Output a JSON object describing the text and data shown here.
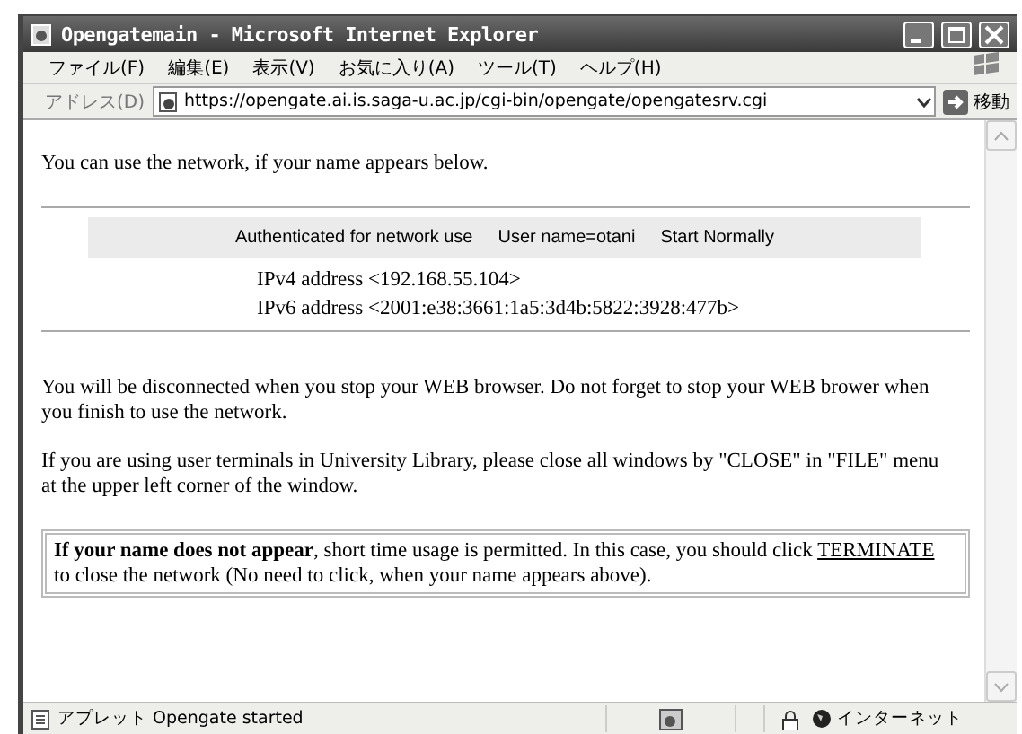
{
  "window": {
    "title": "Opengatemain - Microsoft Internet Explorer"
  },
  "menu": [
    "ファイル(F)",
    "編集(E)",
    "表示(V)",
    "お気に入り(A)",
    "ツール(T)",
    "ヘルプ(H)"
  ],
  "address_bar": {
    "label": "アドレス(D)",
    "url": "https://opengate.ai.is.saga-u.ac.jp/cgi-bin/opengate/opengatesrv.cgi",
    "go": "移動"
  },
  "page": {
    "intro": "You can use the network, if your name appears below.",
    "auth_banner": [
      "Authenticated for network use",
      "User name=otani",
      "Start Normally"
    ],
    "addresses": [
      "IPv4 address <192.168.55.104>",
      "IPv6 address <2001:e38:3661:1a5:3d4b:5822:3928:477b>"
    ],
    "paragraphs": [
      "You will be disconnected when you stop your WEB browser. Do not forget to stop your WEB brower when you finish to use the network.",
      "If you are using user terminals in University Library, please close all windows by \"CLOSE\" in \"FILE\" menu at the upper left corner of the window."
    ],
    "notice": {
      "text": "**If your name does not appear**, short time usage is permitted. In this case, you should click",
      "link": "TERMINATE",
      "text_after": "to close the network (No need to click, when your name appears above)."
    }
  },
  "status_bar": {
    "text": "アプレット Opengate started",
    "zone": "インターネット"
  }
}
